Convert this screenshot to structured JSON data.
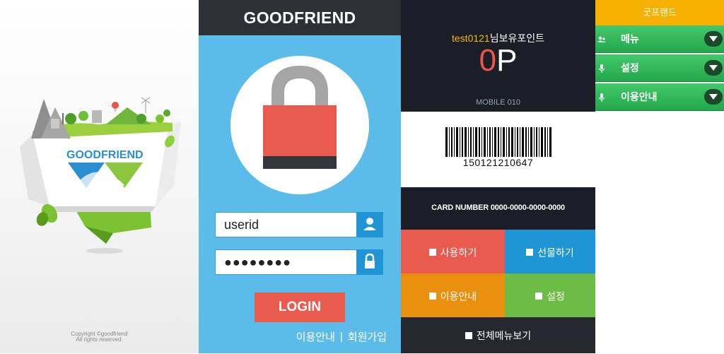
{
  "splash": {
    "brand": "GOODFRIEND",
    "copyright_line1": "Copyright ©goodfriend",
    "copyright_line2": "All rights reserved."
  },
  "login": {
    "header_title": "GOODFRIEND",
    "userid_value": "userid",
    "password_value": "●●●●●●●●",
    "login_label": "LOGIN",
    "link_guide": "이용안내",
    "link_separator": "|",
    "link_signup": "회원가입"
  },
  "card": {
    "user_id": "test0121",
    "greeting_suffix": "님보유포인트",
    "points_value": "0",
    "points_unit": "P",
    "mobile_label": "MOBILE 010",
    "barcode_number": "150121210647",
    "card_number_text": "CARD NUMBER 0000-0000-0000-0000",
    "tiles": {
      "use": "사용하기",
      "gift": "선물하기",
      "guide": "이용안내",
      "settings": "설정",
      "all_menu": "전체메뉴보기"
    }
  },
  "side_menu": {
    "title": "굿프랜드",
    "items": [
      {
        "label": "메뉴"
      },
      {
        "label": "설정"
      },
      {
        "label": "이용안내"
      }
    ]
  },
  "colors": {
    "login_bg": "#5bbbe9",
    "header_dark": "#2d3035",
    "accent_red": "#e95b4f",
    "accent_blue": "#1f95d6",
    "accent_orange": "#ea900e",
    "accent_green": "#6cbc45",
    "menu_title_yellow": "#f6b100",
    "menu_green": "#22a84a",
    "point_user_yellow": "#f5b800"
  },
  "icons": [
    "lock-icon",
    "user-icon",
    "padlock-small-icon",
    "group-icon",
    "mic-icon",
    "chevron-down-icon",
    "handshake-logo-icon"
  ]
}
